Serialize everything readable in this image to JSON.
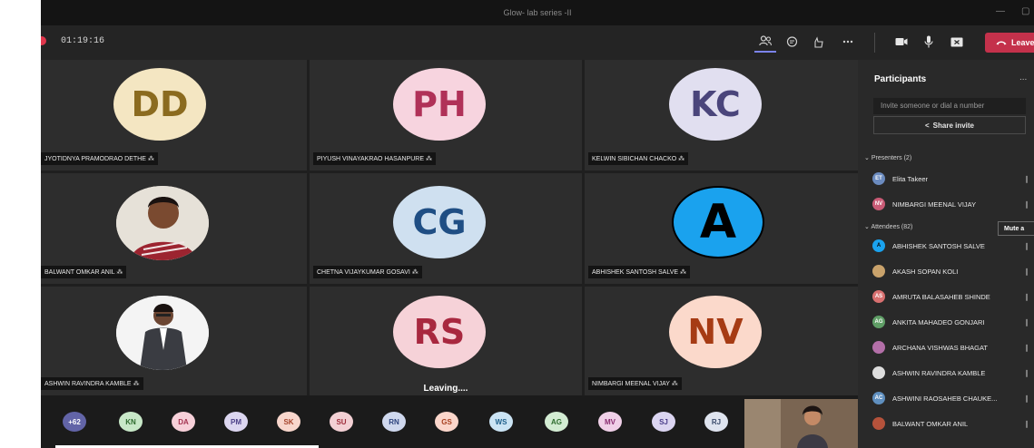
{
  "window": {
    "title": "Glow- lab series -II",
    "minimize_label": "—",
    "restore_label": "▢"
  },
  "toolbar": {
    "timer": "01:19:16",
    "leave_label": "Leave",
    "icons": [
      "people-icon",
      "chat-icon",
      "reactions-icon",
      "more-icon",
      "camera-icon",
      "mic-icon",
      "share-screen-icon"
    ]
  },
  "tiles": [
    {
      "initials": "DD",
      "name": "JYOTIDNYA PRAMODRAO DETHE",
      "bg": "#f4e6c2",
      "fg": "#8b6b1f"
    },
    {
      "initials": "PH",
      "name": "PIYUSH VINAYAKRAO HASANPURE",
      "bg": "#f7d4df",
      "fg": "#b03158"
    },
    {
      "initials": "KC",
      "name": "KELWIN SIBICHAN CHACKO",
      "bg": "#e1dff0",
      "fg": "#4a457b"
    },
    {
      "initials": "",
      "name": "BALWANT OMKAR ANIL",
      "bg": "",
      "fg": ""
    },
    {
      "initials": "CG",
      "name": "CHETNA VIJAYKUMAR GOSAVI",
      "bg": "#cfe0f0",
      "fg": "#1f4e84"
    },
    {
      "initials": "A",
      "name": "ABHISHEK SANTOSH SALVE",
      "bg": "#1aa2ee",
      "fg": "#000000"
    },
    {
      "initials": "",
      "name": "ASHWIN RAVINDRA KAMBLE",
      "bg": "",
      "fg": ""
    },
    {
      "initials": "RS",
      "name": "",
      "bg": "#f6d2d8",
      "fg": "#a8283f"
    },
    {
      "initials": "NV",
      "name": "NIMBARGI MEENAL VIJAY",
      "bg": "#fbd9cb",
      "fg": "#a63b14"
    }
  ],
  "leaving_text": "Leaving....",
  "overflow_chips": [
    {
      "label": "+62",
      "bg": "#6264a7",
      "fg": "#ffffff"
    },
    {
      "label": "KN",
      "bg": "#c8e8c8",
      "fg": "#2e6b2e"
    },
    {
      "label": "DA",
      "bg": "#f7d0d9",
      "fg": "#a33350"
    },
    {
      "label": "PM",
      "bg": "#dcd6f0",
      "fg": "#4b3f87"
    },
    {
      "label": "SK",
      "bg": "#f8d6cc",
      "fg": "#a5432b"
    },
    {
      "label": "SU",
      "bg": "#f3d0d4",
      "fg": "#9e2d3b"
    },
    {
      "label": "RN",
      "bg": "#cfd8ee",
      "fg": "#2d437d"
    },
    {
      "label": "GS",
      "bg": "#fbd6cb",
      "fg": "#a7401f"
    },
    {
      "label": "WS",
      "bg": "#cbe4f4",
      "fg": "#1d5f8a"
    },
    {
      "label": "AG",
      "bg": "#d3ecd3",
      "fg": "#2d6b2d"
    },
    {
      "label": "MV",
      "bg": "#f0d0e8",
      "fg": "#8b2e72"
    },
    {
      "label": "SJ",
      "bg": "#dbd5f1",
      "fg": "#4a3d8a"
    },
    {
      "label": "RJ",
      "bg": "#dfe4ef",
      "fg": "#3a4a6a"
    }
  ],
  "panel": {
    "title": "Participants",
    "more_label": "...",
    "invite_placeholder": "Invite someone or dial a number",
    "share_invite_label": "Share invite",
    "presenters_label": "Presenters (2)",
    "attendees_label": "Attendees (82)",
    "mute_all_label": "Mute a",
    "presenters": [
      {
        "initials": "ET",
        "name": "Elita Takeer",
        "bg": "#6b8bbf"
      },
      {
        "initials": "NV",
        "name": "NIMBARGI MEENAL VIJAY",
        "bg": "#c95b76"
      }
    ],
    "attendees": [
      {
        "initials": "A",
        "name": "ABHISHEK SANTOSH SALVE",
        "bg": "#1aa2ee"
      },
      {
        "initials": "",
        "name": "AKASH SOPAN KOLI",
        "bg": "#c9a26b"
      },
      {
        "initials": "AS",
        "name": "AMRUTA BALASAHEB SHINDE",
        "bg": "#d87070"
      },
      {
        "initials": "AG",
        "name": "ANKITA MAHADEO GONJARI",
        "bg": "#5f9e66"
      },
      {
        "initials": "",
        "name": "ARCHANA VISHWAS BHAGAT",
        "bg": "#b36fa8"
      },
      {
        "initials": "",
        "name": "ASHWIN RAVINDRA KAMBLE",
        "bg": "#dddddd"
      },
      {
        "initials": "AC",
        "name": "ASHWINI RAOSAHEB CHAUKE...",
        "bg": "#5f8fbf"
      },
      {
        "initials": "",
        "name": "BALWANT OMKAR ANIL",
        "bg": "#b5523b"
      }
    ]
  }
}
